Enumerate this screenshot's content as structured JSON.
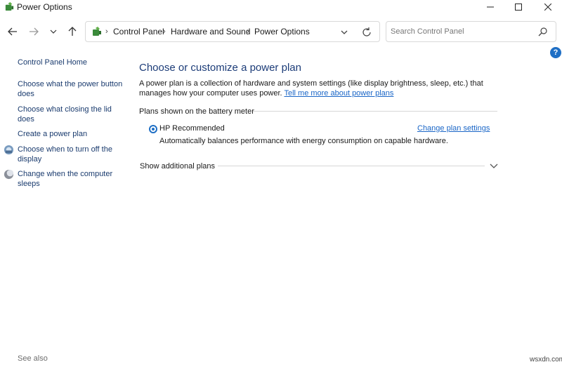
{
  "window": {
    "title": "Power Options",
    "icons": [
      "power-options-icon",
      "minimize-icon",
      "maximize-icon",
      "close-icon"
    ]
  },
  "nav": {
    "icons": [
      "back-arrow-icon",
      "forward-arrow-icon",
      "recent-locations-chevron-icon",
      "up-arrow-icon"
    ]
  },
  "address": {
    "breadcrumbs": [
      "Control Panel",
      "Hardware and Sound",
      "Power Options"
    ],
    "icons": [
      "control-panel-icon",
      "chevron-right-icon",
      "address-dropdown-icon",
      "refresh-icon"
    ]
  },
  "search": {
    "placeholder": "Search Control Panel",
    "icon": "search-icon"
  },
  "help_icon": "?",
  "sidebar": {
    "home": "Control Panel Home",
    "links": [
      {
        "label_line1": "Choose what the power button",
        "label_line2": "does"
      },
      {
        "label_line1": "Choose what closing the lid",
        "label_line2": "does"
      },
      {
        "label_line1": "Create a power plan",
        "label_line2": ""
      },
      {
        "label_line1": "Choose when to turn off the",
        "label_line2": "display",
        "icon": "display-icon"
      },
      {
        "label_line1": "Change when the computer",
        "label_line2": "sleeps",
        "icon": "moon-sleep-icon"
      }
    ],
    "see_also": "See also"
  },
  "main": {
    "title": "Choose or customize a power plan",
    "description_line1": "A power plan is a collection of hardware and system settings (like display brightness, sleep, etc.) that",
    "description_line2": "manages how your computer uses power. ",
    "description_link": "Tell me more about power plans",
    "group_header": "Plans shown on the battery meter",
    "plan": {
      "name": "HP Recommended",
      "selected": true,
      "settings_link": "Change plan settings",
      "description": "Automatically balances performance with energy consumption on capable hardware."
    },
    "additional_plans": "Show additional plans"
  },
  "colors": {
    "title_blue": "#1c3c78",
    "link_blue": "#1a66c7",
    "accent": "#1f6fc5"
  },
  "watermark": "wsxdn.com"
}
